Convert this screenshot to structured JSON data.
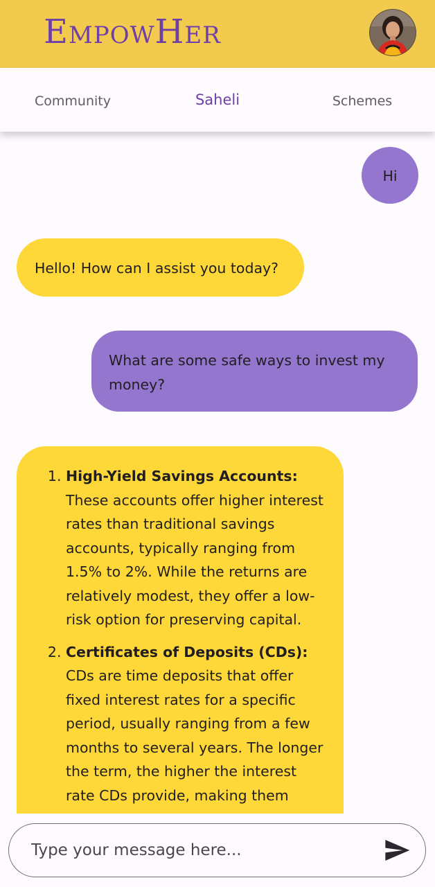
{
  "app": {
    "title": "EmpowHer"
  },
  "profile": {
    "avatar_icon": "user-avatar"
  },
  "tabs": [
    {
      "label": "Community",
      "active": false
    },
    {
      "label": "Saheli",
      "active": true
    },
    {
      "label": "Schemes",
      "active": false
    }
  ],
  "messages": [
    {
      "role": "user",
      "text": "Hi"
    },
    {
      "role": "bot",
      "text": "Hello! How can I assist you today?"
    },
    {
      "role": "user",
      "text": "What are some safe ways to invest my money?"
    },
    {
      "role": "bot",
      "items": [
        {
          "title": "High-Yield Savings Accounts:",
          "body": "These accounts offer higher interest rates than traditional savings accounts, typically ranging from 1.5% to 2%. While the returns are relatively modest, they offer a low-risk option for preserving capital."
        },
        {
          "title": "Certificates of Deposits (CDs):",
          "body": "CDs are time deposits that offer fixed interest rates for a specific period, usually ranging from a few months to several years. The longer the term, the higher the interest rate CDs provide, making them"
        }
      ]
    }
  ],
  "composer": {
    "placeholder": "Type your message here...",
    "send_icon": "send-icon"
  },
  "colors": {
    "header": "#f2cb4e",
    "brand": "#6f3fa8",
    "bot_bubble": "#fdd838",
    "user_bubble": "#9476ce",
    "background": "#fefbfe"
  }
}
